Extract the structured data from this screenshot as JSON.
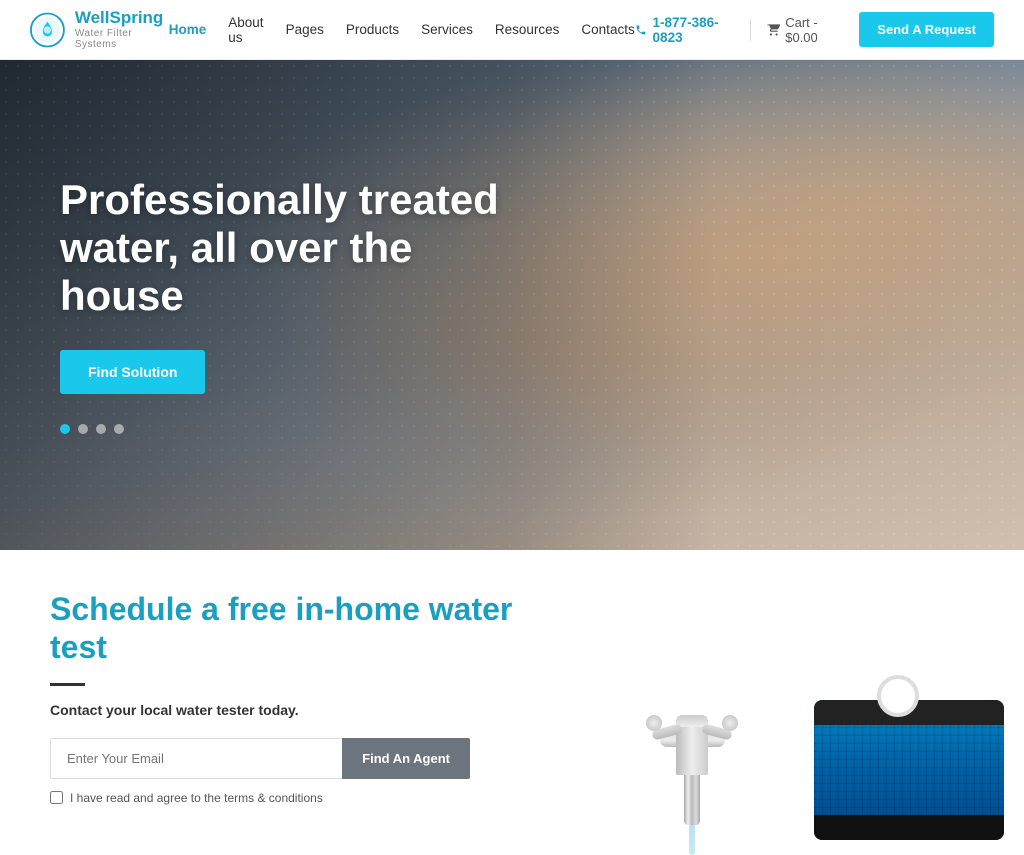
{
  "brand": {
    "name": "WellSpring",
    "tagline": "Water Filter Systems",
    "logo_color": "#1a9fc0"
  },
  "nav": {
    "items": [
      {
        "label": "Home",
        "active": true
      },
      {
        "label": "About us",
        "active": false
      },
      {
        "label": "Pages",
        "active": false
      },
      {
        "label": "Products",
        "active": false
      },
      {
        "label": "Services",
        "active": false
      },
      {
        "label": "Resources",
        "active": false
      },
      {
        "label": "Contacts",
        "active": false
      }
    ]
  },
  "header": {
    "phone": "1-877-386-0823",
    "cart_label": "Cart - $0.00",
    "cta_label": "Send A Request"
  },
  "hero": {
    "title": "Professionally treated water, all over the house",
    "cta_label": "Find Solution",
    "dots": [
      true,
      false,
      false,
      false
    ]
  },
  "section": {
    "title": "Schedule a free in-home water test",
    "subtitle": "Contact your local water tester today.",
    "email_placeholder": "Enter Your Email",
    "find_agent_label": "Find An Agent",
    "terms_label": "I have read and agree to the terms & conditions"
  }
}
